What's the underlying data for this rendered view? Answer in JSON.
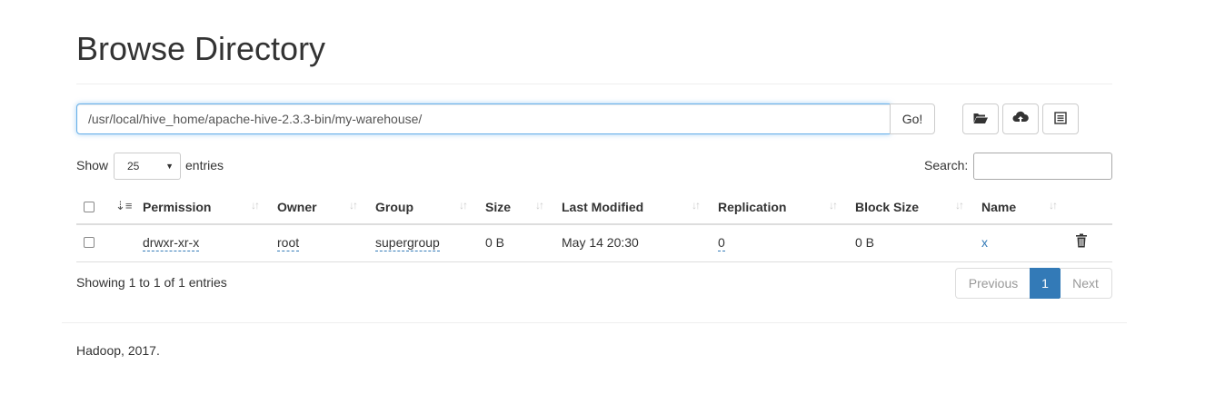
{
  "page": {
    "title": "Browse Directory"
  },
  "toolbar": {
    "path_value": "/usr/local/hive_home/apache-hive-2.3.3-bin/my-warehouse/",
    "go_label": "Go!",
    "icons": [
      "folder-open-icon",
      "cloud-upload-icon",
      "list-icon"
    ]
  },
  "controls": {
    "show_label": "Show",
    "page_size": "25",
    "entries_label": "entries",
    "search_label": "Search:",
    "search_value": ""
  },
  "table": {
    "columns": [
      "Permission",
      "Owner",
      "Group",
      "Size",
      "Last Modified",
      "Replication",
      "Block Size",
      "Name"
    ],
    "rows": [
      {
        "permission": "drwxr-xr-x",
        "owner": "root",
        "group": "supergroup",
        "size": "0 B",
        "last_modified": "May 14 20:30",
        "replication": "0",
        "block_size": "0 B",
        "name": "x"
      }
    ]
  },
  "pagination": {
    "info": "Showing 1 to 1 of 1 entries",
    "previous": "Previous",
    "current": "1",
    "next": "Next"
  },
  "footer": {
    "text": "Hadoop, 2017."
  },
  "colors": {
    "accent": "#337ab7",
    "focus": "#66afe9"
  }
}
